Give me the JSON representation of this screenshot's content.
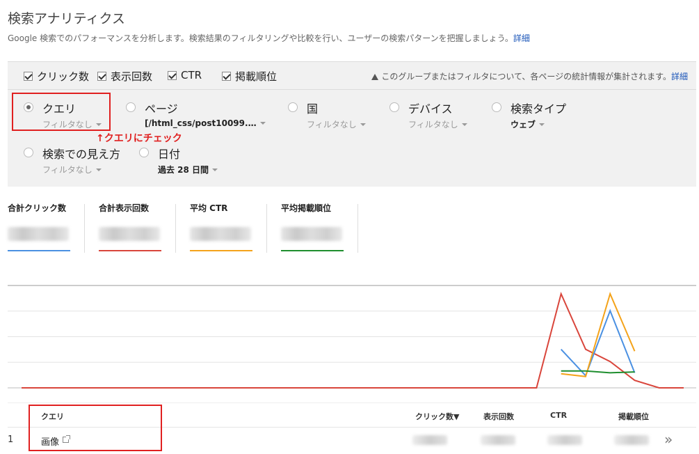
{
  "header": {
    "title": "検索アナリティクス",
    "description": "Google 検索でのパフォーマンスを分析します。検索結果のフィルタリングや比較を行い、ユーザーの検索パターンを把握しましょう。",
    "details_link": "詳細"
  },
  "metrics_toggle": {
    "items": [
      {
        "label": "クリック数",
        "checked": true
      },
      {
        "label": "表示回数",
        "checked": true
      },
      {
        "label": "CTR",
        "checked": true
      },
      {
        "label": "掲載順位",
        "checked": true
      }
    ],
    "notice": "このグループまたはフィルタについて、各ページの統計情報が集計されます。",
    "notice_link": "詳細"
  },
  "dimensions": [
    {
      "label": "クエリ",
      "filter": "フィルタなし",
      "selected": true
    },
    {
      "label": "ページ",
      "filter": "[/html_css/post10099.…",
      "selected": false
    },
    {
      "label": "国",
      "filter": "フィルタなし",
      "selected": false
    },
    {
      "label": "デバイス",
      "filter": "フィルタなし",
      "selected": false
    },
    {
      "label": "検索タイプ",
      "filter": "ウェブ",
      "selected": false
    },
    {
      "label": "検索での見え方",
      "filter": "フィルタなし",
      "selected": false
    },
    {
      "label": "日付",
      "filter": "過去 28 日間",
      "selected": false
    }
  ],
  "annotation": "↑クエリにチェック",
  "summary": {
    "cards": [
      {
        "title": "合計クリック数",
        "color": "#4a90e2"
      },
      {
        "title": "合計表示回数",
        "color": "#d9453b"
      },
      {
        "title": "平均 CTR",
        "color": "#f4a31a"
      },
      {
        "title": "平均掲載順位",
        "color": "#1e8e2e"
      }
    ]
  },
  "chart_data": {
    "type": "line",
    "x": [
      1,
      2,
      3,
      4,
      5,
      6,
      7,
      8,
      9,
      10,
      11,
      12,
      13,
      14,
      15,
      16,
      17,
      18,
      19,
      20,
      21,
      22,
      23,
      24,
      25,
      26,
      27,
      28
    ],
    "ylim": [
      0,
      1
    ],
    "grid": true,
    "series": [
      {
        "name": "",
        "color": "#d9453b",
        "values": [
          0,
          0,
          0,
          0,
          0,
          0,
          0,
          0,
          0,
          0,
          0,
          0,
          0,
          0,
          0,
          0,
          0,
          0,
          0,
          0,
          0,
          0,
          1.0,
          0.41,
          0.28,
          0.08,
          0,
          0
        ]
      },
      {
        "name": "",
        "color": "#4a90e2",
        "values": [
          null,
          null,
          null,
          null,
          null,
          null,
          null,
          null,
          null,
          null,
          null,
          null,
          null,
          null,
          null,
          null,
          null,
          null,
          null,
          null,
          null,
          null,
          0.41,
          0.13,
          0.82,
          0.16,
          null,
          null
        ]
      },
      {
        "name": "",
        "color": "#f4a31a",
        "values": [
          null,
          null,
          null,
          null,
          null,
          null,
          null,
          null,
          null,
          null,
          null,
          null,
          null,
          null,
          null,
          null,
          null,
          null,
          null,
          null,
          null,
          null,
          0.15,
          0.12,
          1.0,
          0.39,
          null,
          null
        ]
      },
      {
        "name": "",
        "color": "#1e8e2e",
        "values": [
          null,
          null,
          null,
          null,
          null,
          null,
          null,
          null,
          null,
          null,
          null,
          null,
          null,
          null,
          null,
          null,
          null,
          null,
          null,
          null,
          null,
          null,
          0.18,
          0.18,
          0.16,
          0.17,
          null,
          null
        ]
      }
    ]
  },
  "table": {
    "headers": {
      "query": "クエリ",
      "clicks": "クリック数▼",
      "impressions": "表示回数",
      "ctr": "CTR",
      "position": "掲載順位"
    },
    "rows": [
      {
        "index": "1",
        "query": "画像"
      }
    ],
    "more_icon": "»"
  }
}
